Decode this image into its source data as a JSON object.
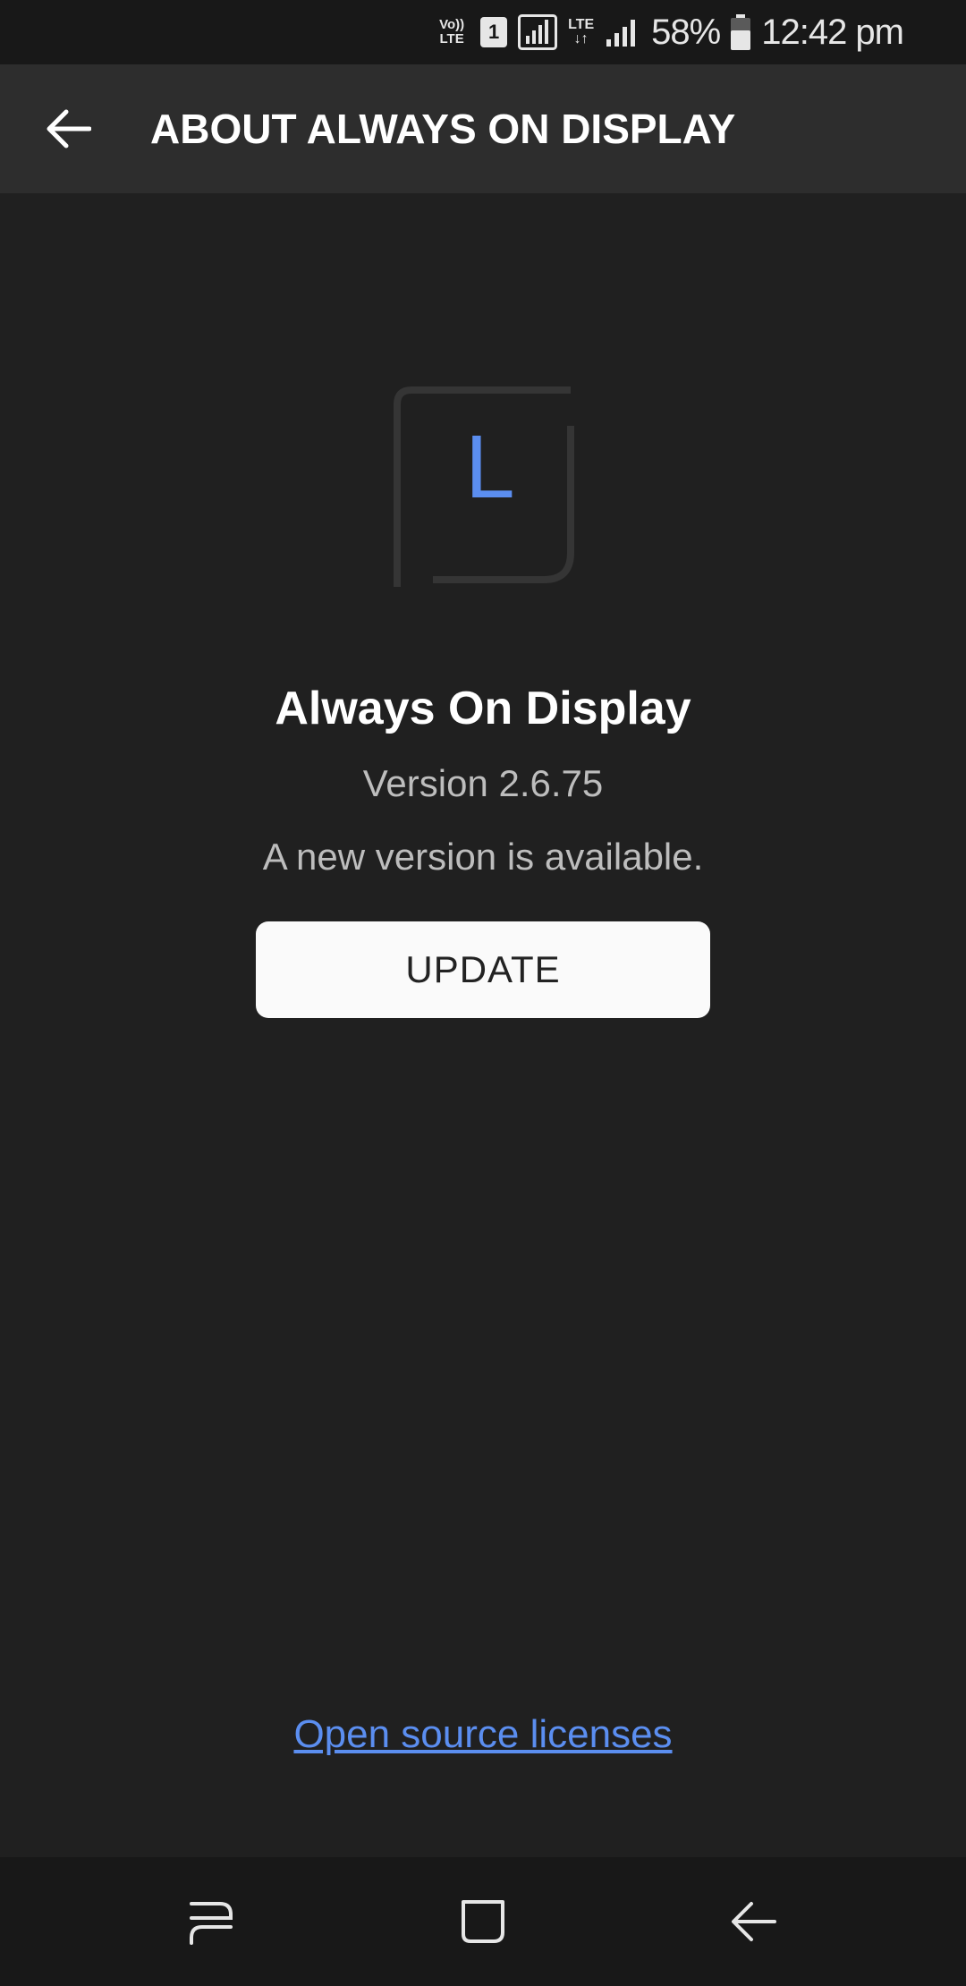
{
  "status_bar": {
    "volte_top": "Vo))",
    "volte_bottom": "LTE",
    "sim_number": "1",
    "lte_label": "LTE",
    "lte_arrows": "↓↑",
    "battery": "58%",
    "time": "12:42 pm"
  },
  "app_bar": {
    "title": "ABOUT ALWAYS ON DISPLAY"
  },
  "app_info": {
    "logo_letter": "L",
    "name": "Always On Display",
    "version": "Version 2.6.75",
    "update_status": "A new version is available.",
    "update_label": "UPDATE"
  },
  "footer": {
    "licenses_link": "Open source licenses"
  },
  "colors": {
    "background": "#202020",
    "app_bar": "#2d2d2d",
    "accent": "#5b8ef0",
    "button": "#fafafa"
  }
}
